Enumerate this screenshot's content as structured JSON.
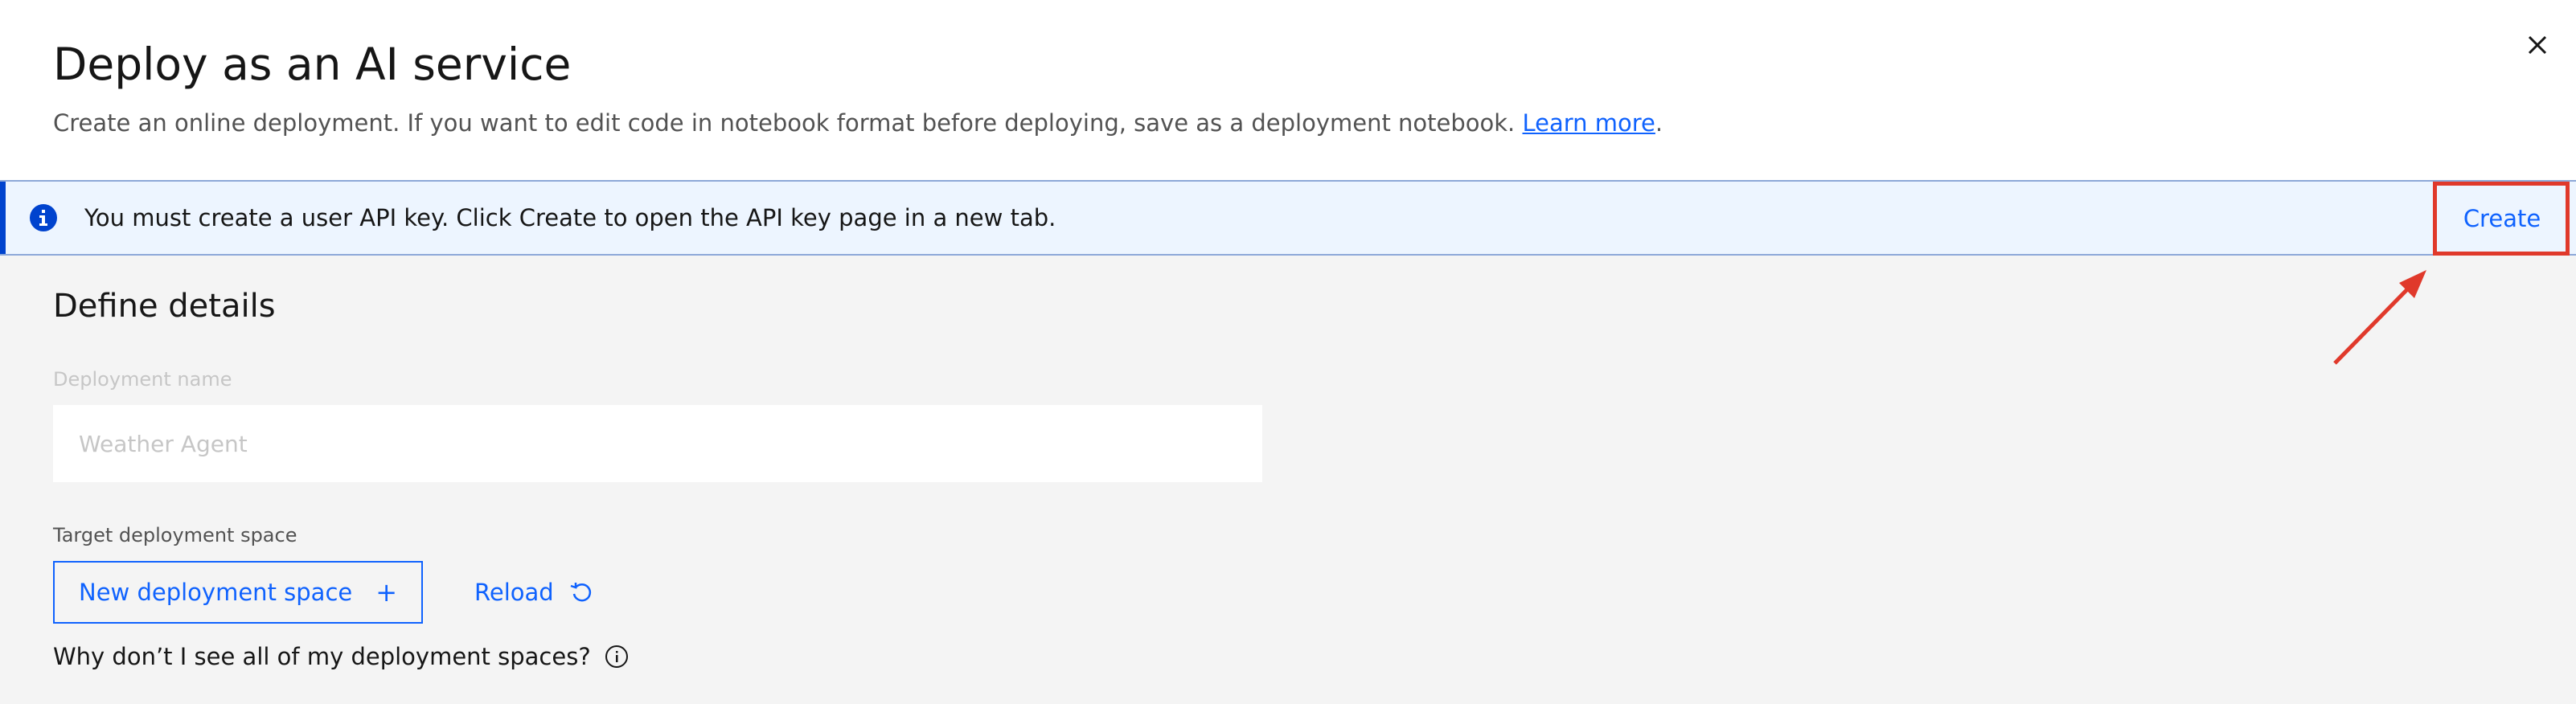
{
  "modal": {
    "title": "Deploy as an AI service",
    "subtitle": "Create an online deployment. If you want to edit code in notebook format before deploying, save as a deployment notebook.",
    "learn_more": "Learn more",
    "subtitle_end": "."
  },
  "notification": {
    "message": "You must create a user API key. Click Create to open the API key page in a new tab.",
    "action_label": "Create"
  },
  "details": {
    "section_title": "Define details",
    "deployment_name_label": "Deployment name",
    "deployment_name_placeholder": "Weather Agent",
    "target_space_label": "Target deployment space",
    "new_space_button": "New deployment space",
    "reload_button": "Reload",
    "help_question": "Why don’t I see all of my deployment spaces?"
  },
  "icons": {
    "close": "close-icon",
    "info": "info-icon",
    "plus": "plus-icon",
    "reload": "reload-icon",
    "help": "information-icon"
  },
  "colors": {
    "accent": "#0f62fe",
    "notification_bg": "#edf5ff",
    "notification_bar": "#0043ce",
    "annotation_red": "#e0392b"
  }
}
